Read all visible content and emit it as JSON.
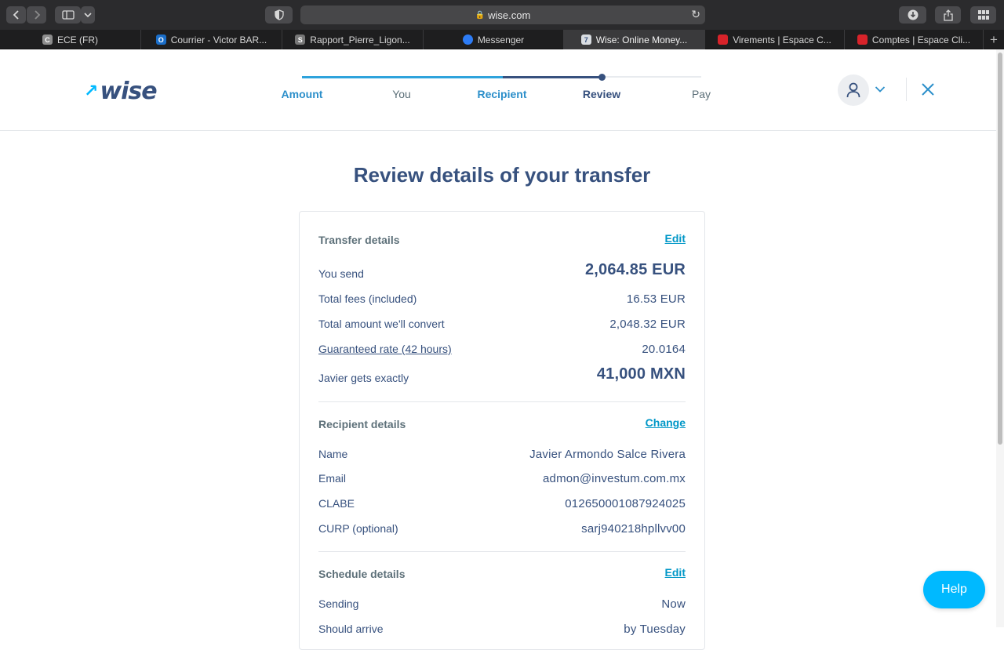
{
  "browser": {
    "url": "wise.com",
    "tabs": [
      {
        "label": "ECE (FR)",
        "favicon": "C",
        "color": "#8d8d8d"
      },
      {
        "label": "Courrier - Victor BAR...",
        "favicon": "O",
        "color": "#1a6ec9"
      },
      {
        "label": "Rapport_Pierre_Ligon...",
        "favicon": "S",
        "color": "#777777"
      },
      {
        "label": "Messenger",
        "favicon": "",
        "color": "#2d7cf6"
      },
      {
        "label": "Wise: Online Money...",
        "favicon": "7",
        "color": "#d9dde2"
      },
      {
        "label": "Virements | Espace C...",
        "favicon": "",
        "color": "#d8232a"
      },
      {
        "label": "Comptes | Espace Cli...",
        "favicon": "",
        "color": "#d8232a"
      }
    ]
  },
  "header": {
    "logo": "wise",
    "steps": [
      {
        "label": "Amount",
        "state": "done"
      },
      {
        "label": "You",
        "state": "todo"
      },
      {
        "label": "Recipient",
        "state": "done"
      },
      {
        "label": "Review",
        "state": "current"
      },
      {
        "label": "Pay",
        "state": "todo"
      }
    ]
  },
  "main": {
    "title": "Review details of your transfer",
    "transfer": {
      "title": "Transfer details",
      "edit": "Edit",
      "you_send_label": "You send",
      "you_send": "2,064.85 EUR",
      "fees_label": "Total fees (included)",
      "fees": "16.53 EUR",
      "convert_label": "Total amount we'll convert",
      "convert": "2,048.32 EUR",
      "rate_label": "Guaranteed rate (42 hours)",
      "rate": "20.0164",
      "gets_label": "Javier gets exactly",
      "gets": "41,000 MXN"
    },
    "recipient": {
      "title": "Recipient details",
      "change": "Change",
      "name_label": "Name",
      "name": "Javier Armondo Salce Rivera",
      "email_label": "Email",
      "email": "admon@investum.com.mx",
      "clabe_label": "CLABE",
      "clabe": "012650001087924025",
      "curp_label": "CURP (optional)",
      "curp": "sarj940218hpllvv00"
    },
    "schedule": {
      "title": "Schedule details",
      "edit": "Edit",
      "sending_label": "Sending",
      "sending": "Now",
      "arrive_label": "Should arrive",
      "arrive": "by Tuesday"
    }
  },
  "help": "Help",
  "colors": {
    "brand_navy": "#37517e",
    "brand_blue": "#00b9ff",
    "link": "#0097c7"
  }
}
